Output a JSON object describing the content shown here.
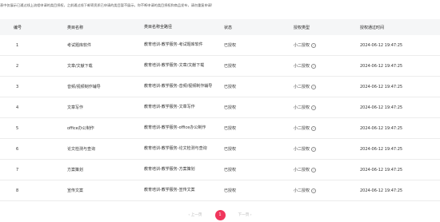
{
  "notice": "表中仅展示已通过线上流程申请的类目授权，之前通过线下邮寄资质已申请的类目暂不展示。你不断申请的类目授权和商品发布，请勿重复申请!",
  "table": {
    "headers": [
      "编号",
      "类目名称",
      "类目名称全路径",
      "状态",
      "授权类型",
      "授权通过时间"
    ],
    "rows": [
      {
        "no": "1",
        "name": "考试题库软件",
        "path": "教育培训-教学服务-考试题库软件",
        "status": "已授权",
        "type": "小二授权",
        "time": "2024-06-12 19:47:25"
      },
      {
        "no": "2",
        "name": "文章/文献下载",
        "path": "教育培训-教学服务-文章/文献下载",
        "status": "已授权",
        "type": "小二授权",
        "time": "2024-06-12 19:47:25"
      },
      {
        "no": "3",
        "name": "音频/视频制作辅导",
        "path": "教育培训-教学服务-音频/视频制作辅导",
        "status": "已授权",
        "type": "小二授权",
        "time": "2024-06-12 19:47:25"
      },
      {
        "no": "4",
        "name": "文章写作",
        "path": "教育培训-教学服务-文章写作",
        "status": "已授权",
        "type": "小二授权",
        "time": "2024-06-12 19:47:25"
      },
      {
        "no": "5",
        "name": "office办公制作",
        "path": "教育培训-教学服务-office办公制作",
        "status": "已授权",
        "type": "小二授权",
        "time": "2024-06-12 19:47:25"
      },
      {
        "no": "6",
        "name": "论文检测与查询",
        "path": "教育培训-教学服务-论文检测与查询",
        "status": "已授权",
        "type": "小二授权",
        "time": "2024-06-12 19:47:25"
      },
      {
        "no": "7",
        "name": "方案策划",
        "path": "教育培训-教学服务-方案策划",
        "status": "已授权",
        "type": "小二授权",
        "time": "2024-06-12 19:47:25"
      },
      {
        "no": "8",
        "name": "宣传文案",
        "path": "教育培训-教学服务-宣传文案",
        "status": "已授权",
        "type": "小二授权",
        "time": "2024-06-12 19:47:25"
      }
    ]
  },
  "pager": {
    "prev": "‹ 上一页",
    "current": "1",
    "next": "下一页 ›"
  },
  "icons": {
    "help": "question-circle-icon"
  },
  "colors": {
    "accent": "#f0365c",
    "header_bg": "#f5f6f7"
  }
}
